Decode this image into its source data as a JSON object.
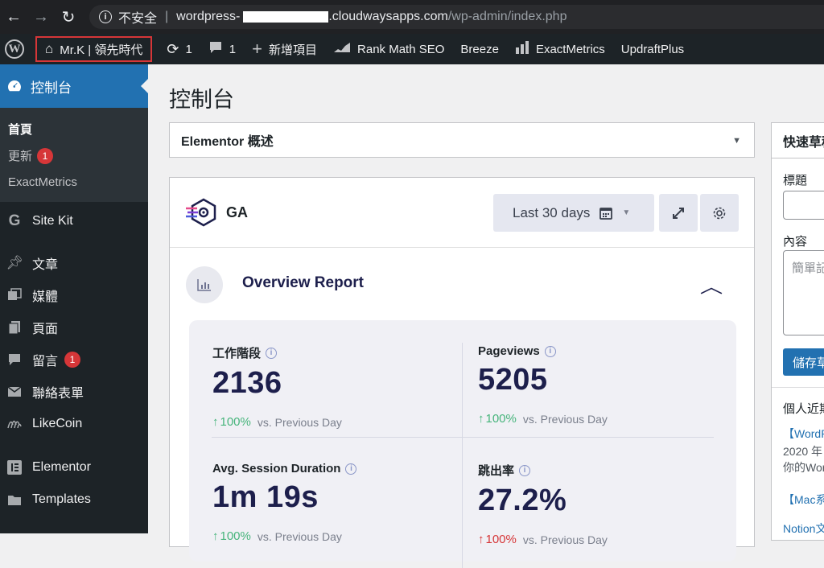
{
  "browser": {
    "security_label": "不安全",
    "url_host_start": "wordpress-",
    "url_host_end": ".cloudwaysapps.com",
    "url_path": "/wp-admin/index.php"
  },
  "adminbar": {
    "site_name": "Mr.K | 領先時代",
    "updates_count": "1",
    "comments_count": "1",
    "new_label": "新增項目",
    "rankmath_label": "Rank Math SEO",
    "breeze_label": "Breeze",
    "exactmetrics_label": "ExactMetrics",
    "updraft_label": "UpdraftPlus"
  },
  "sidebar": {
    "dashboard": "控制台",
    "sub_home": "首頁",
    "sub_updates": "更新",
    "sub_updates_badge": "1",
    "sub_exactmetrics": "ExactMetrics",
    "sitekit": "Site Kit",
    "posts": "文章",
    "media": "媒體",
    "pages": "頁面",
    "comments": "留言",
    "comments_badge": "1",
    "contact": "聯絡表單",
    "likecoin": "LikeCoin",
    "elementor": "Elementor",
    "templates": "Templates"
  },
  "main": {
    "title": "控制台",
    "elementor_overview": "Elementor 概述",
    "ga_title": "GA",
    "date_range": "Last 30 days",
    "overview_title": "Overview Report",
    "stats": [
      {
        "label": "工作階段",
        "value": "2136",
        "change": "100%",
        "vs": "vs. Previous Day"
      },
      {
        "label": "Pageviews",
        "value": "5205",
        "change": "100%",
        "vs": "vs. Previous Day"
      },
      {
        "label": "Avg. Session Duration",
        "value": "1m 19s",
        "change": "100%",
        "vs": "vs. Previous Day"
      },
      {
        "label": "跳出率",
        "value": "27.2%",
        "change": "100%",
        "vs": "vs. Previous Day"
      }
    ]
  },
  "quickdraft": {
    "title": "快速草稿",
    "title_label": "標題",
    "content_label": "內容",
    "content_placeholder": "簡單記",
    "save_label": "儲存草稿",
    "recent_heading": "個人近期",
    "link1": "【WordPress",
    "date1": "2020 年",
    "text1": "你的WordPress",
    "link2": "【Mac系統",
    "link3": "Notion文"
  }
}
